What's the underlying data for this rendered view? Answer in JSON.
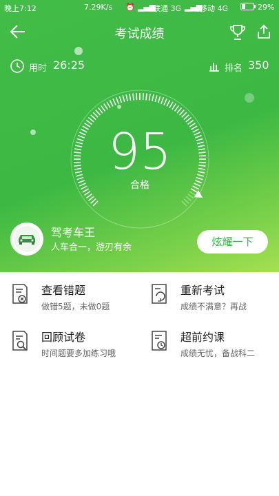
{
  "status_bar": {
    "time": "晚上7:12",
    "speed": "7.29K/s",
    "carrier1": "联通 3G",
    "carrier2": "移动 4G",
    "battery": "29%"
  },
  "header": {
    "title": "考试成绩"
  },
  "stats": {
    "time_label": "用时",
    "time_value": "26:25",
    "rank_label": "排名",
    "rank_value": "350"
  },
  "result": {
    "score": "95",
    "status": "合格",
    "score_fraction": 0.95
  },
  "user": {
    "title": "驾考车王",
    "subtitle": "人车合一，游刃有余",
    "brag_label": "炫耀一下"
  },
  "actions": [
    {
      "title": "查看错题",
      "subtitle": "做错5题，未做0题",
      "icon": "wrong-questions-icon"
    },
    {
      "title": "重新考试",
      "subtitle": "成绩不满意？再战",
      "icon": "retake-exam-icon"
    },
    {
      "title": "回顾试卷",
      "subtitle": "时间题要多加练习哦",
      "icon": "review-paper-icon"
    },
    {
      "title": "超前约课",
      "subtitle": "成绩无忧，备战科二",
      "icon": "book-lesson-icon"
    }
  ],
  "colors": {
    "primary_green": "#3cb843",
    "accent_green": "#a6df52"
  }
}
